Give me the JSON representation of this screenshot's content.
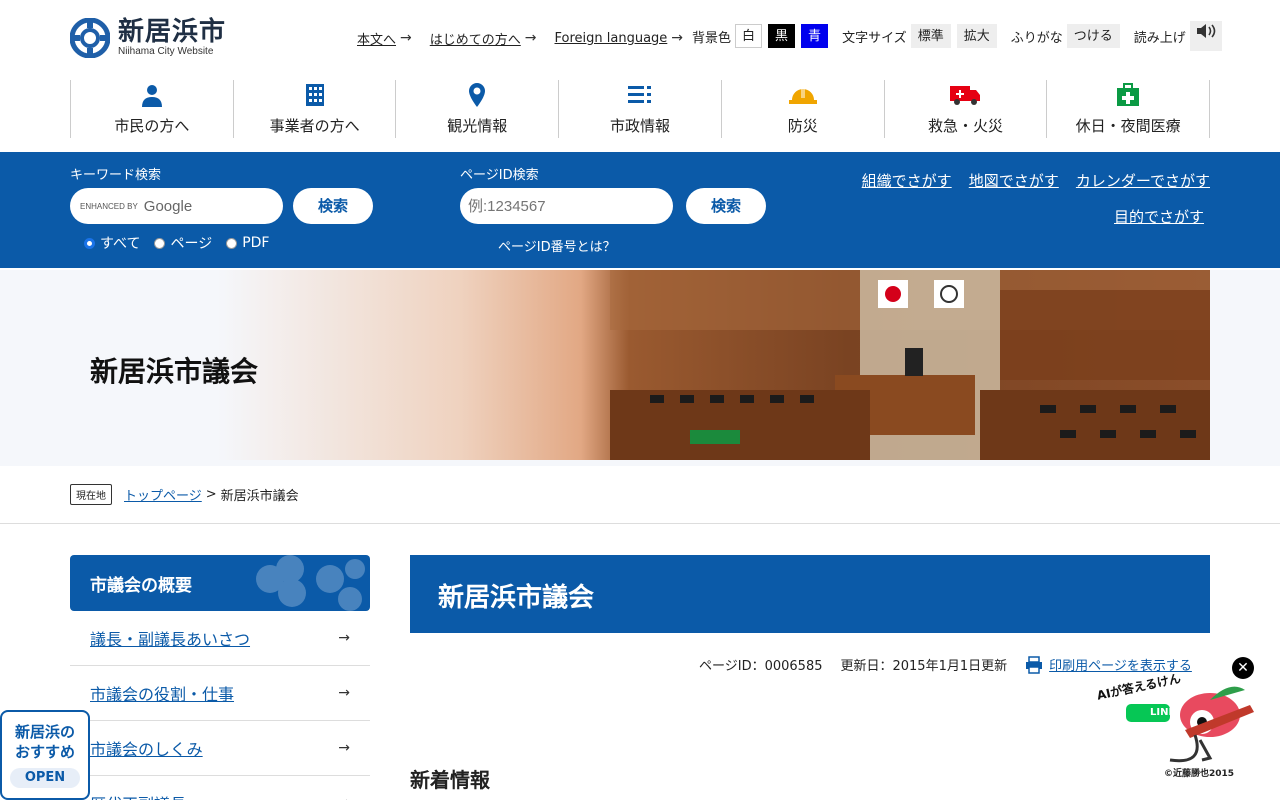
{
  "header": {
    "logo_title": "新居浜市",
    "logo_sub": "Niihama City Website",
    "links": [
      {
        "label": "本文へ"
      },
      {
        "label": "はじめての方へ"
      },
      {
        "label": "Foreign language"
      }
    ],
    "bg_label": "背景色",
    "bg_options": [
      "白",
      "黒",
      "青"
    ],
    "fontsize_label": "文字サイズ",
    "fontsize_options": [
      "標準",
      "拡大"
    ],
    "furigana_label": "ふりがな",
    "furigana_button": "つける",
    "readaloud_label": "読み上げ"
  },
  "nav": [
    {
      "label": "市民の方へ",
      "icon": "person-icon"
    },
    {
      "label": "事業者の方へ",
      "icon": "building-icon"
    },
    {
      "label": "観光情報",
      "icon": "map-pin-icon"
    },
    {
      "label": "市政情報",
      "icon": "list-icon"
    },
    {
      "label": "防災",
      "icon": "helmet-icon"
    },
    {
      "label": "救急・火災",
      "icon": "ambulance-icon"
    },
    {
      "label": "休日・夜間医療",
      "icon": "medical-kit-icon"
    }
  ],
  "search": {
    "keyword_label": "キーワード検索",
    "google_badge_small": "ENHANCED BY",
    "google_badge": "Google",
    "search_button": "検索",
    "radios": [
      "すべて",
      "ページ",
      "PDF"
    ],
    "pageid_label": "ページID検索",
    "pageid_placeholder": "例:1234567",
    "pageid_button": "検索",
    "pageid_help": "ページID番号とは？",
    "find_links": [
      "組織でさがす",
      "地図でさがす",
      "カレンダーでさがす",
      "目的でさがす"
    ]
  },
  "hero": {
    "title": "新居浜市議会"
  },
  "breadcrumb": {
    "tag": "現在地",
    "home": "トップページ",
    "sep": ">",
    "current": "新居浜市議会"
  },
  "sidebar": {
    "heading": "市議会の概要",
    "items": [
      {
        "label": "議長・副議長あいさつ"
      },
      {
        "label": "市議会の役割・仕事"
      },
      {
        "label": "市議会のしくみ"
      },
      {
        "label": "歴代正副議長"
      }
    ]
  },
  "main": {
    "title": "新居浜市議会",
    "page_id": "ページID：0006585",
    "updated": "更新日：2015年1月1日更新",
    "print_link": "印刷用ページを表示する",
    "news_heading": "新着情報"
  },
  "floating": {
    "recommend_line1": "新居浜の",
    "recommend_line2": "おすすめ",
    "recommend_open": "OPEN",
    "ai_text": "AIが答えるけん",
    "ai_line": "LINE",
    "ai_credit": "©近藤勝也2015"
  },
  "colors": {
    "brand_blue": "#0b5aa8",
    "text": "#222222"
  }
}
